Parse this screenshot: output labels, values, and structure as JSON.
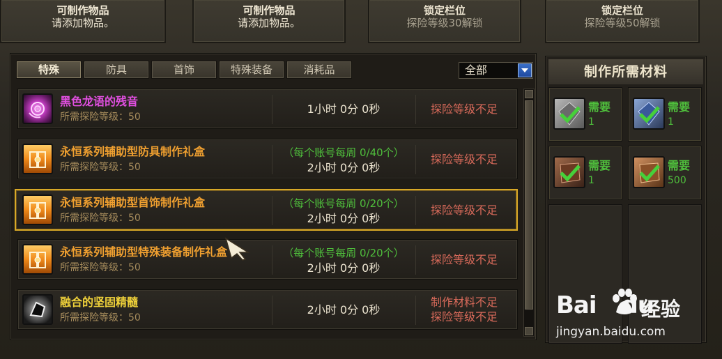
{
  "slots": [
    {
      "line1": "可制作物品",
      "line2": "请添加物品。",
      "locked": false
    },
    {
      "line1": "可制作物品",
      "line2": "请添加物品。",
      "locked": false
    },
    {
      "line1": "锁定栏位",
      "line2": "探险等级30解锁",
      "locked": true
    },
    {
      "line1": "锁定栏位",
      "line2": "探险等级50解锁",
      "locked": true
    }
  ],
  "tabs": [
    {
      "label": "特殊",
      "active": true
    },
    {
      "label": "防具",
      "active": false
    },
    {
      "label": "首饰",
      "active": false
    },
    {
      "label": "特殊装备",
      "active": false
    },
    {
      "label": "消耗品",
      "active": false
    }
  ],
  "filter": {
    "selected": "全部"
  },
  "recipes": [
    {
      "name": "黑色龙语的残音",
      "name_color": "#e04fe0",
      "req": "所需探险等级：50",
      "weekly": "",
      "time": "1小时 0分 0秒",
      "status1": "探险等级不足",
      "status2": "",
      "icon": "purple-rose-icon",
      "selected": false
    },
    {
      "name": "永恒系列辅助型防具制作礼盒",
      "name_color": "#f0a030",
      "req": "所需探险等级：50",
      "weekly": "（每个账号每周 0/40个）",
      "time": "2小时 0分 0秒",
      "status1": "探险等级不足",
      "status2": "",
      "icon": "orange-giftbox-icon",
      "selected": false
    },
    {
      "name": "永恒系列辅助型首饰制作礼盒",
      "name_color": "#f0a030",
      "req": "所需探险等级：50",
      "weekly": "（每个账号每周 0/20个）",
      "time": "2小时 0分 0秒",
      "status1": "探险等级不足",
      "status2": "",
      "icon": "orange-giftbox-icon",
      "selected": true
    },
    {
      "name": "永恒系列辅助型特殊装备制作礼盒",
      "name_color": "#f0a030",
      "req": "所需探险等级：50",
      "weekly": "（每个账号每周 0/20个）",
      "time": "2小时 0分 0秒",
      "status1": "探险等级不足",
      "status2": "",
      "icon": "orange-giftbox-icon",
      "selected": false
    },
    {
      "name": "融合的坚固精髓",
      "name_color": "#f0d23a",
      "req": "所需探险等级：50",
      "weekly": "",
      "time": "2小时 0分 0秒",
      "status1": "制作材料不足",
      "status2": "探险等级不足",
      "icon": "dark-essence-icon",
      "selected": false
    }
  ],
  "materials": {
    "title": "制作所需材料",
    "items": [
      {
        "need": "需要",
        "qty": "1",
        "icon": "grey-crystal-check-icon"
      },
      {
        "need": "需要",
        "qty": "1",
        "icon": "blue-crystal-check-icon"
      },
      {
        "need": "需要",
        "qty": "1",
        "icon": "brown-ore-check-icon"
      },
      {
        "need": "需要",
        "qty": "500",
        "icon": "bronze-ore-check-icon"
      }
    ]
  },
  "watermark": {
    "logo": "Bai",
    "logo2": "du",
    "cn": "经验",
    "url": "jingyan.baidu.com"
  }
}
